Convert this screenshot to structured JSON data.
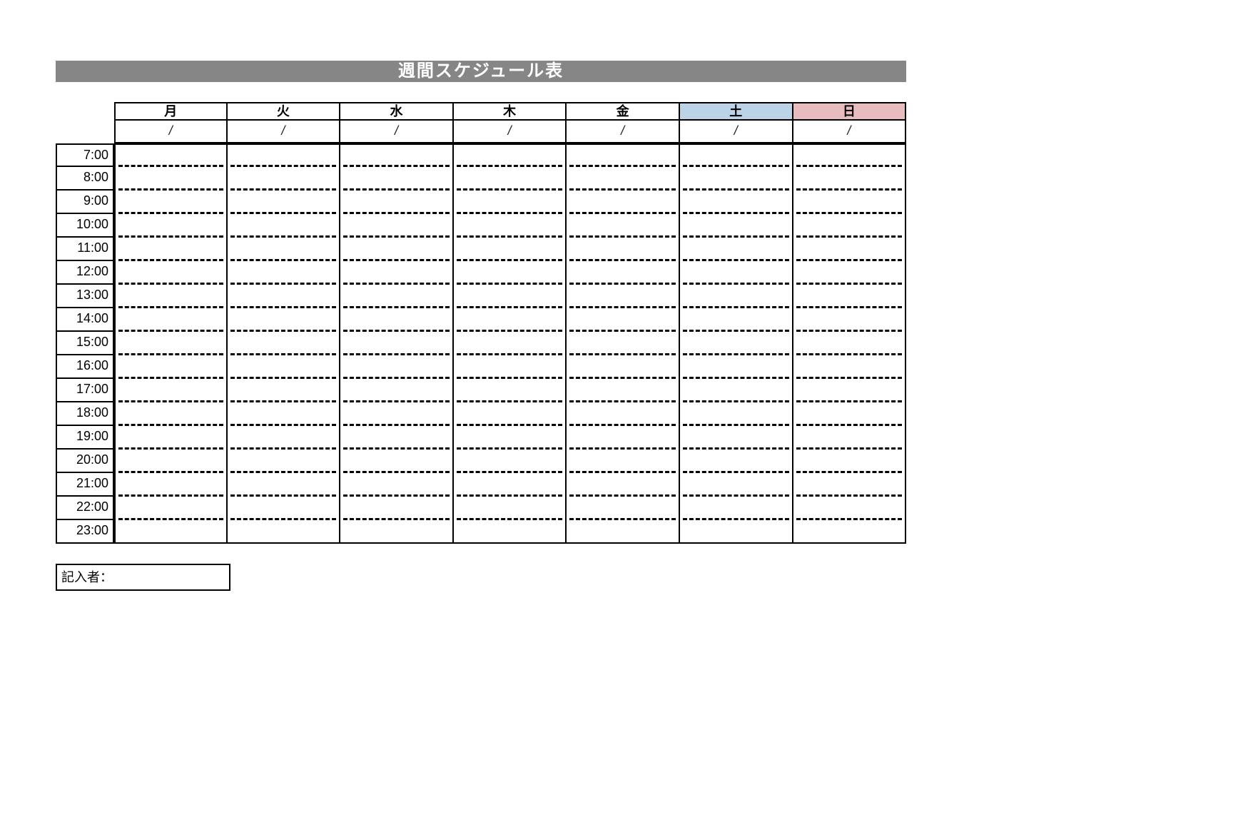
{
  "title": "週間スケジュール表",
  "days": [
    "月",
    "火",
    "水",
    "木",
    "金",
    "土",
    "日"
  ],
  "dates": [
    "/",
    "/",
    "/",
    "/",
    "/",
    "/",
    "/"
  ],
  "times": [
    "7:00",
    "8:00",
    "9:00",
    "10:00",
    "11:00",
    "12:00",
    "13:00",
    "14:00",
    "15:00",
    "16:00",
    "17:00",
    "18:00",
    "19:00",
    "20:00",
    "21:00",
    "22:00",
    "23:00"
  ],
  "author_label": "記入者：",
  "colors": {
    "sat_bg": "#bcd2e6",
    "sun_bg": "#e8bcbe",
    "header_bg": "#868686"
  }
}
